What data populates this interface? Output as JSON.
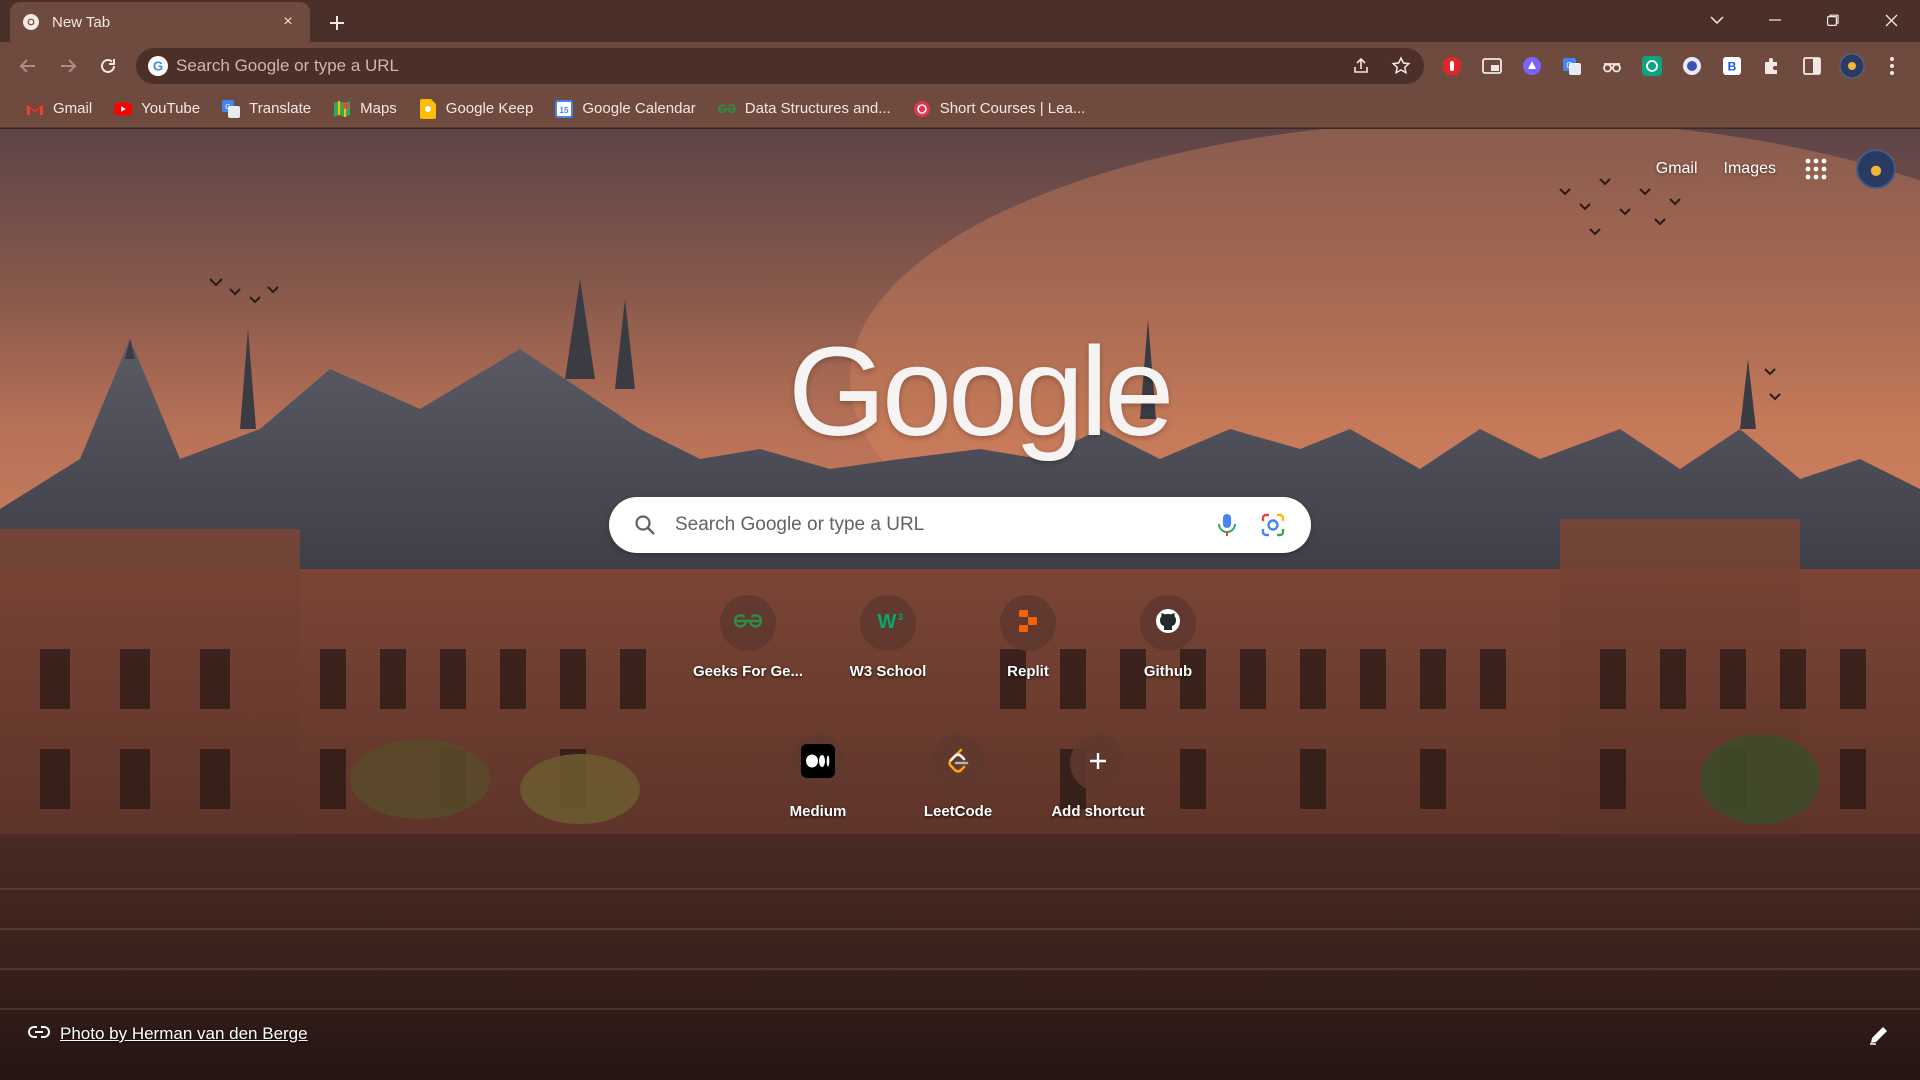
{
  "tab": {
    "title": "New Tab",
    "close": "×"
  },
  "omnibox": {
    "placeholder": "Search Google or type a URL"
  },
  "bookmarks": [
    {
      "label": "Gmail",
      "icon": "gmail-icon"
    },
    {
      "label": "YouTube",
      "icon": "youtube-icon"
    },
    {
      "label": "Translate",
      "icon": "translate-icon"
    },
    {
      "label": "Maps",
      "icon": "maps-icon"
    },
    {
      "label": "Google Keep",
      "icon": "keep-icon"
    },
    {
      "label": "Google Calendar",
      "icon": "calendar-icon"
    },
    {
      "label": "Data Structures and...",
      "icon": "gfg-icon"
    },
    {
      "label": "Short Courses | Lea...",
      "icon": "courses-icon"
    }
  ],
  "ntp": {
    "gmail_link": "Gmail",
    "images_link": "Images",
    "logo": "Google",
    "search_placeholder": "Search Google or type a URL",
    "credit": "Photo by Herman van den Berge"
  },
  "shortcuts": [
    {
      "label": "Geeks For Ge...",
      "icon": "geeksforgeeks-icon"
    },
    {
      "label": "W3 School",
      "icon": "w3schools-icon"
    },
    {
      "label": "Replit",
      "icon": "replit-icon"
    },
    {
      "label": "Github",
      "icon": "github-icon"
    },
    {
      "label": "Medium",
      "icon": "medium-icon"
    },
    {
      "label": "LeetCode",
      "icon": "leetcode-icon"
    },
    {
      "label": "Add shortcut",
      "icon": "plus-icon"
    }
  ],
  "colors": {
    "frame": "#4a3029",
    "toolbar": "#6e4a3f",
    "omnibox": "#4c2f28",
    "tile": "#60382e"
  }
}
